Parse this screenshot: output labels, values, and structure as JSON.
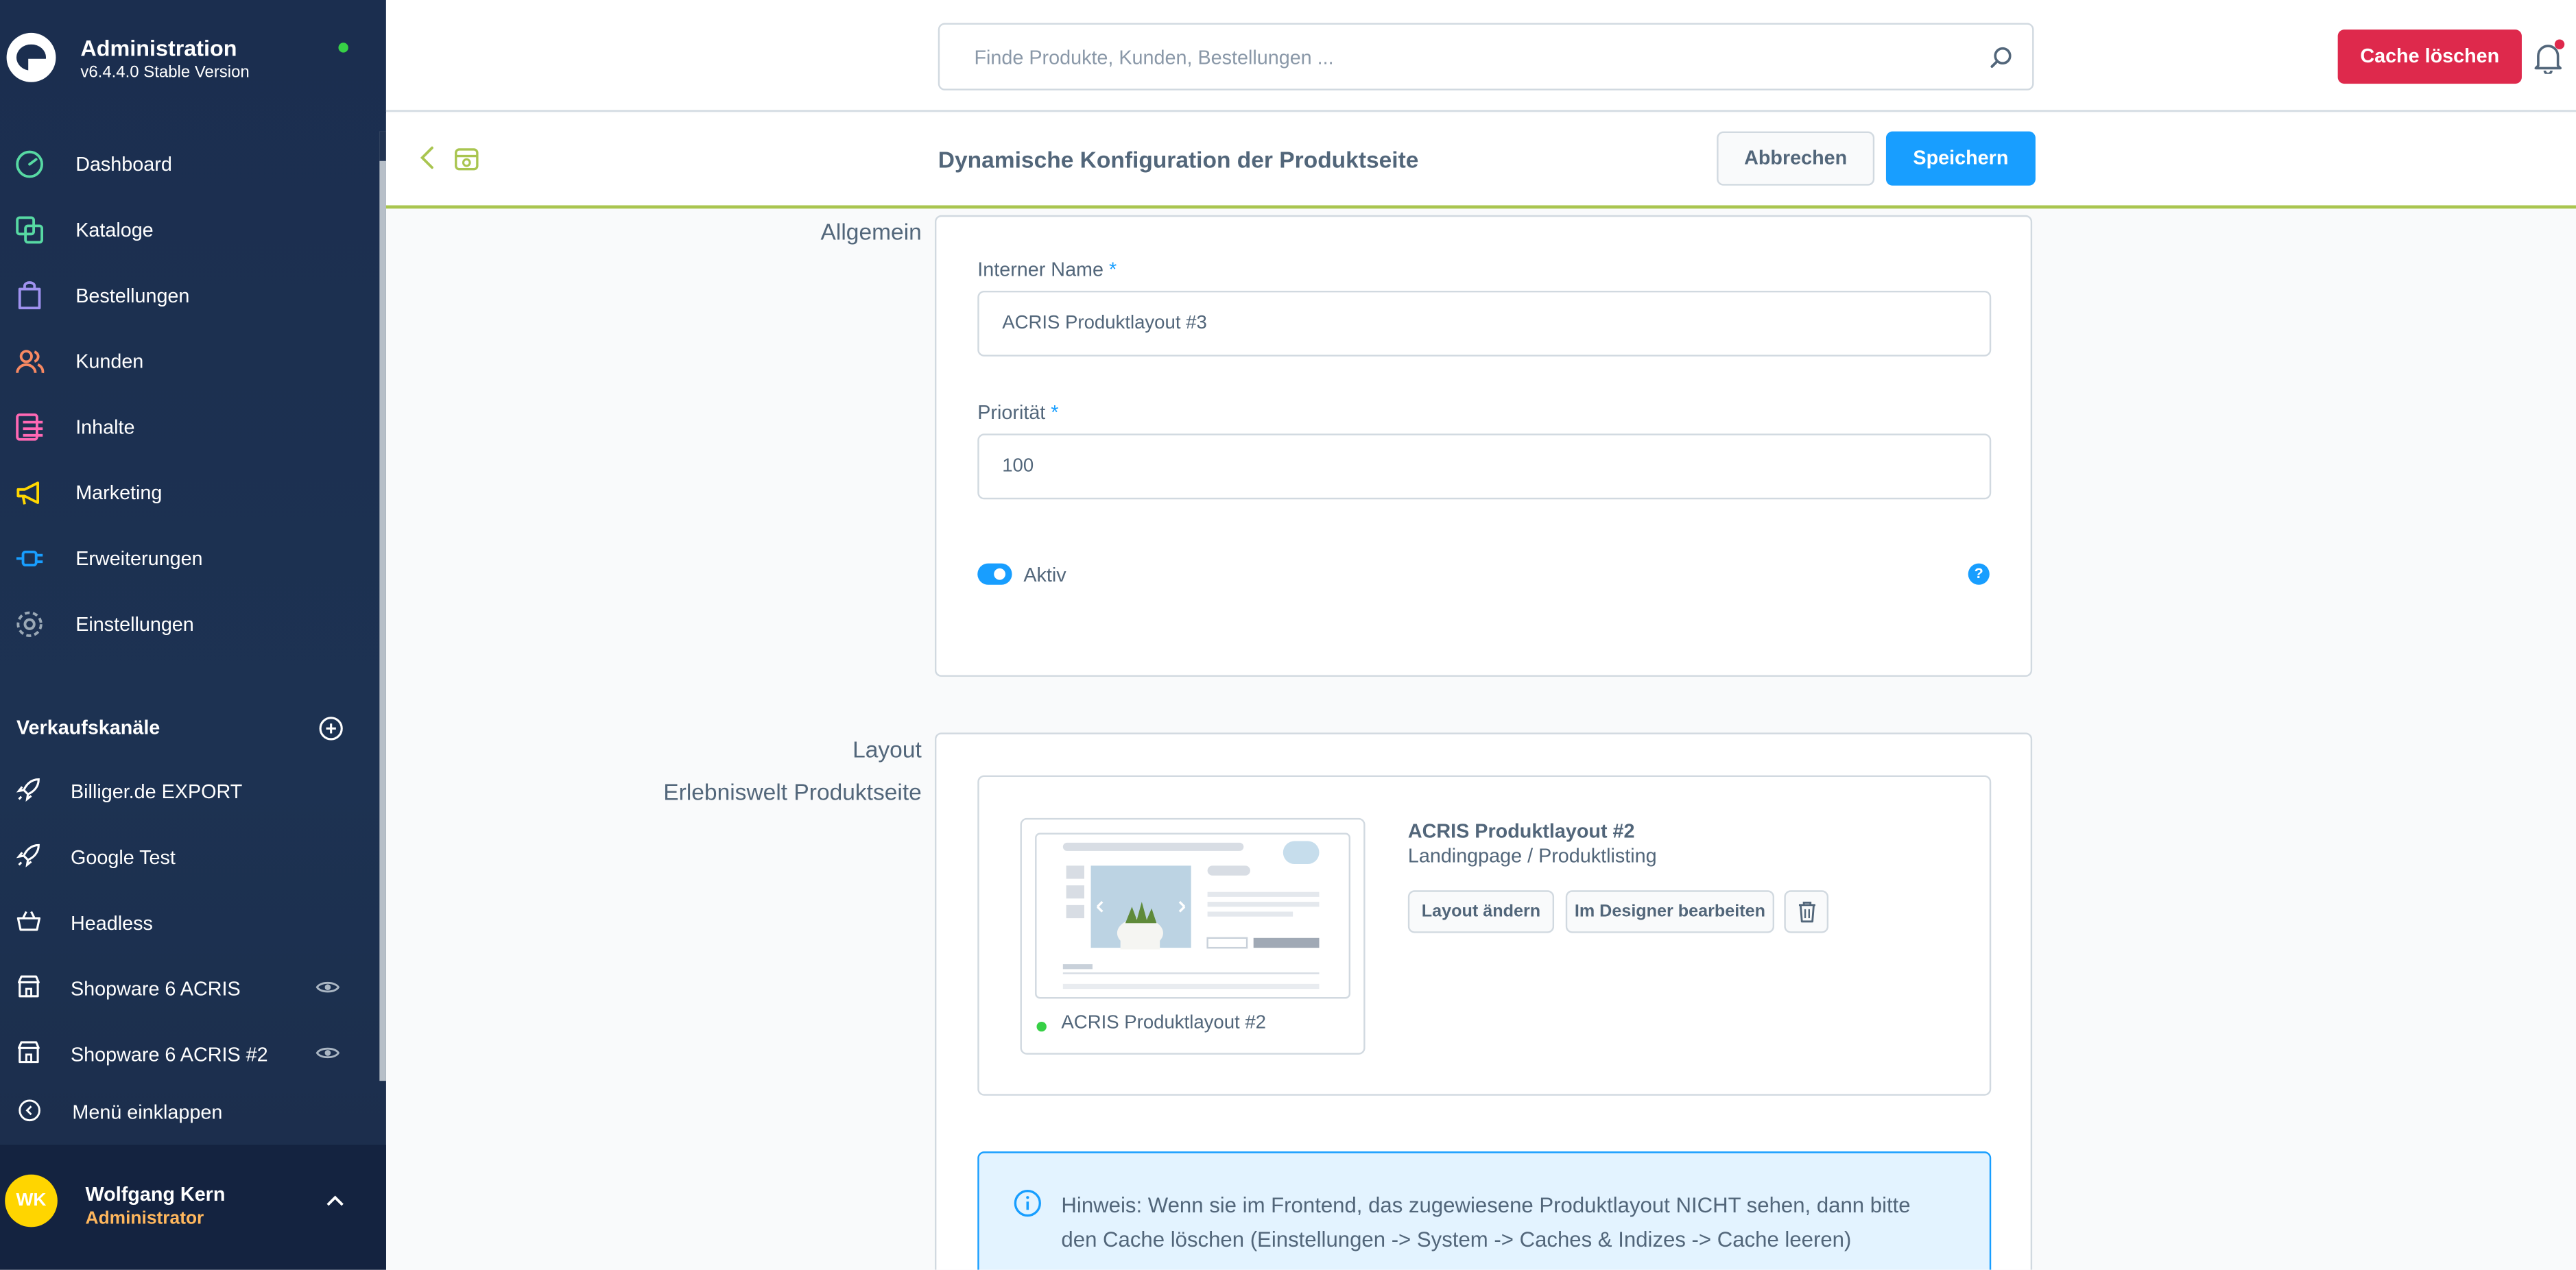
{
  "sidebar": {
    "title": "Administration",
    "version": "v6.4.4.0 Stable Version",
    "nav": [
      {
        "label": "Dashboard",
        "icon": "dashboard-icon",
        "color": "#57d9a3"
      },
      {
        "label": "Kataloge",
        "icon": "catalog-icon",
        "color": "#57d9a3"
      },
      {
        "label": "Bestellungen",
        "icon": "orders-icon",
        "color": "#a092f0"
      },
      {
        "label": "Kunden",
        "icon": "customers-icon",
        "color": "#f88962"
      },
      {
        "label": "Inhalte",
        "icon": "content-icon",
        "color": "#ff68b4"
      },
      {
        "label": "Marketing",
        "icon": "marketing-icon",
        "color": "#ffd700"
      },
      {
        "label": "Erweiterungen",
        "icon": "extensions-icon",
        "color": "#189eff"
      },
      {
        "label": "Einstellungen",
        "icon": "settings-icon",
        "color": "#9aa8b5"
      }
    ],
    "sales_channels": {
      "title": "Verkaufskanäle",
      "items": [
        {
          "label": "Billiger.de EXPORT",
          "icon": "rocket-icon"
        },
        {
          "label": "Google Test",
          "icon": "rocket-icon"
        },
        {
          "label": "Headless",
          "icon": "basket-icon"
        },
        {
          "label": "Shopware 6 ACRIS",
          "icon": "storefront-icon"
        },
        {
          "label": "Shopware 6 ACRIS #2",
          "icon": "storefront-icon"
        }
      ]
    },
    "collapse_label": "Menü einklappen",
    "user": {
      "initials": "WK",
      "name": "Wolfgang Kern",
      "role": "Administrator"
    }
  },
  "topbar": {
    "search_placeholder": "Finde Produkte, Kunden, Bestellungen ...",
    "cache_button": "Cache löschen"
  },
  "smartbar": {
    "title": "Dynamische Konfiguration der Produktseite",
    "cancel": "Abbrechen",
    "save": "Speichern"
  },
  "general": {
    "section_label": "Allgemein",
    "name_label": "Interner Name",
    "name_value": "ACRIS Produktlayout #3",
    "priority_label": "Priorität",
    "priority_value": "100",
    "required_marker": "*",
    "active_label": "Aktiv",
    "active": true,
    "help": "?"
  },
  "layout": {
    "section_label": "Layout",
    "sub_label": "Erlebniswelt Produktseite",
    "preview_name": "ACRIS Produktlayout #2",
    "layout_name": "ACRIS Produktlayout #2",
    "layout_type": "Landingpage / Produktlisting",
    "change_button": "Layout ändern",
    "designer_button": "Im Designer bearbeiten",
    "notice": "Hinweis: Wenn sie im Frontend, das zugewiesene Produktlayout NICHT sehen, dann bitte den Cache löschen (Einstellungen -> System -> Caches & Indizes -> Cache leeren)"
  },
  "colors": {
    "sidebar": "#1b2e4f",
    "primary": "#189eff",
    "danger": "#de294c",
    "accent_line": "#a9c550",
    "status_online": "#37d046",
    "avatar": "#ffd500"
  }
}
